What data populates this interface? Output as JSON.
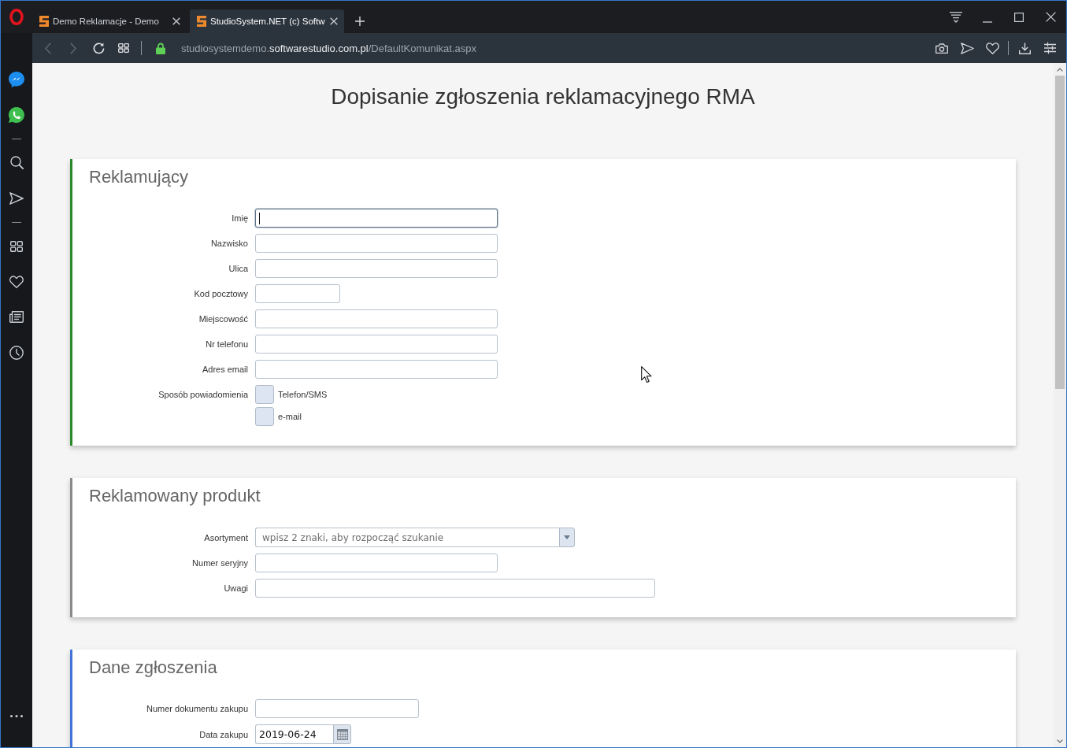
{
  "browser": {
    "tabs": [
      {
        "title": "Demo Reklamacje - Demo",
        "selected": false
      },
      {
        "title": "StudioSystem.NET (c) Softw",
        "selected": true
      }
    ],
    "toolbar": {
      "back": {
        "disabled": true
      },
      "forward": {
        "disabled": true
      }
    },
    "address": {
      "secure": true,
      "host_prefix": "studiosystemdemo.",
      "domain": "softwarestudio.com.pl",
      "path": "/DefaultKomunikat.aspx"
    }
  },
  "page": {
    "title": "Dopisanie zgłoszenia reklamacyjnego RMA",
    "sections": [
      {
        "title": "Reklamujący",
        "color": "#2a8a2a",
        "fields": [
          {
            "kind": "text",
            "label": "Imię",
            "focused": true
          },
          {
            "kind": "text",
            "label": "Nazwisko",
            "focused": false
          },
          {
            "kind": "text",
            "label": "Ulica",
            "focused": false
          },
          {
            "kind": "text",
            "label": "Kod pocztowy",
            "focused": false
          },
          {
            "kind": "text",
            "label": "Miejscowość",
            "focused": false
          },
          {
            "kind": "text",
            "label": "Nr telefonu",
            "focused": false
          },
          {
            "kind": "text",
            "label": "Adres email",
            "focused": false
          },
          {
            "kind": "checkboxes",
            "label": "Sposób powiadomienia",
            "focused": false,
            "options": [
              {
                "label": "Telefon/SMS",
                "checked": false
              },
              {
                "label": "e-mail",
                "checked": false
              }
            ]
          }
        ]
      },
      {
        "title": "Reklamowany produkt",
        "color": "#8a8a8a",
        "fields": [
          {
            "kind": "combo",
            "label": "Asortyment",
            "placeholder": "wpisz 2 znaki, aby rozpocząć szukanie",
            "focused": false
          },
          {
            "kind": "text",
            "label": "Numer seryjny",
            "focused": false
          },
          {
            "kind": "text",
            "label": "Uwagi",
            "focused": false
          }
        ]
      },
      {
        "title": "Dane zgłoszenia",
        "color": "#4274d8",
        "fields": [
          {
            "kind": "text",
            "label": "Numer dokumentu zakupu",
            "focused": false
          },
          {
            "kind": "date",
            "label": "Data zakupu",
            "value": "2019-06-24",
            "focused": false
          }
        ]
      }
    ]
  }
}
